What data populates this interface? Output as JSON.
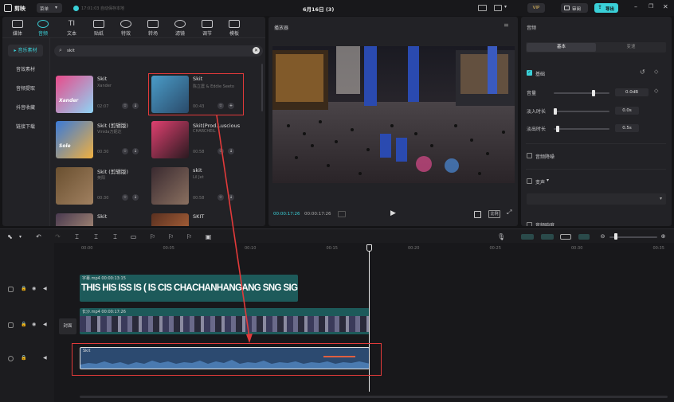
{
  "titlebar": {
    "app_name": "剪映",
    "menu_label": "菜单",
    "autosave": "17:01:03 自动保存本地",
    "project_title": "6月16日 (3)",
    "vip_label": "VIP",
    "review_label": "审阅",
    "export_label": "导出"
  },
  "top_tabs": [
    {
      "label": "媒体"
    },
    {
      "label": "音频"
    },
    {
      "label": "文本"
    },
    {
      "label": "贴纸"
    },
    {
      "label": "特效"
    },
    {
      "label": "转场"
    },
    {
      "label": "滤镜"
    },
    {
      "label": "调节"
    },
    {
      "label": "模板"
    }
  ],
  "categories": [
    {
      "label": "音乐素材"
    },
    {
      "label": "音效素材"
    },
    {
      "label": "音频提取"
    },
    {
      "label": "抖音收藏"
    },
    {
      "label": "链接下载"
    }
  ],
  "search": {
    "value": "skit"
  },
  "music_items": [
    {
      "title": "Skit",
      "artist": "Xander",
      "duration": "02:07",
      "thumb_text": "Xander",
      "color1": "#e84b8a",
      "color2": "#8ed4f5"
    },
    {
      "title": "Skit",
      "artist": "陈立農 & Eddie Seeto",
      "duration": "00:43",
      "thumb_text": "",
      "color1": "#4a9cc8",
      "color2": "#2a4a6a"
    },
    {
      "title": "Skit (剪辑版)",
      "artist": "Vinida万妮达",
      "duration": "00:30",
      "thumb_text": "Sole",
      "color1": "#3a7ad8",
      "color2": "#f0b040"
    },
    {
      "title": "Skit(Prod.Luscious B3) - 剪辑版",
      "artist": "CHARCHEIL",
      "duration": "00:58",
      "thumb_text": "",
      "color1": "#e04070",
      "color2": "#2a1a20"
    },
    {
      "title": "Skit (剪辑版)",
      "artist": "英阳",
      "duration": "00:30",
      "thumb_text": "",
      "color1": "#6a5030",
      "color2": "#a08060"
    },
    {
      "title": "skit",
      "artist": "Lil Jet",
      "duration": "00:58",
      "thumb_text": "",
      "color1": "#3a2a30",
      "color2": "#8a7060"
    },
    {
      "title": "Skit",
      "artist": "",
      "duration": "",
      "thumb_text": "",
      "color1": "#4a3a50",
      "color2": "#c0a080"
    },
    {
      "title": "SKIT",
      "artist": "",
      "duration": "",
      "thumb_text": "",
      "color1": "#5a3020",
      "color2": "#c07040"
    }
  ],
  "player": {
    "title": "播放器",
    "current_time": "00:00:17:26",
    "total_time": "00:00:17:26",
    "ratio_label": "比例"
  },
  "right_panel": {
    "title": "音频",
    "tab_basic": "基本",
    "tab_speed": "变速",
    "section_basic": "基础",
    "volume_label": "音量",
    "volume_value": "0.0dB",
    "volume_level": 0.8,
    "fadein_label": "淡入时长",
    "fadein_value": "0.0s",
    "fadeout_label": "淡出时长",
    "fadeout_value": "0.5s",
    "denoise_label": "音频降噪",
    "voice_label": "变声",
    "loudness_label": "音频响度"
  },
  "timeline": {
    "ruler": [
      "00:00",
      "00:05",
      "00:10",
      "00:15",
      "00:20",
      "00:25",
      "00:30",
      "00:35"
    ],
    "text_clip_label": "字幕.mp4  00:00:13:15",
    "text_clip_content": "THIS HIS ISS IS ( IS CIS CHACHANHANGANG SNG SIG",
    "video_clip_label": "长沙.mp4  00:00:17:26",
    "cover_label": "封面",
    "audio_clip_label": "Skit"
  },
  "colors": {
    "accent": "#3ad0d8",
    "export_bg": "#3ad0d8",
    "red_annotation": "#e23a3a",
    "audio_clip": "#2c4a70",
    "video_clip": "#1d5a5a"
  }
}
